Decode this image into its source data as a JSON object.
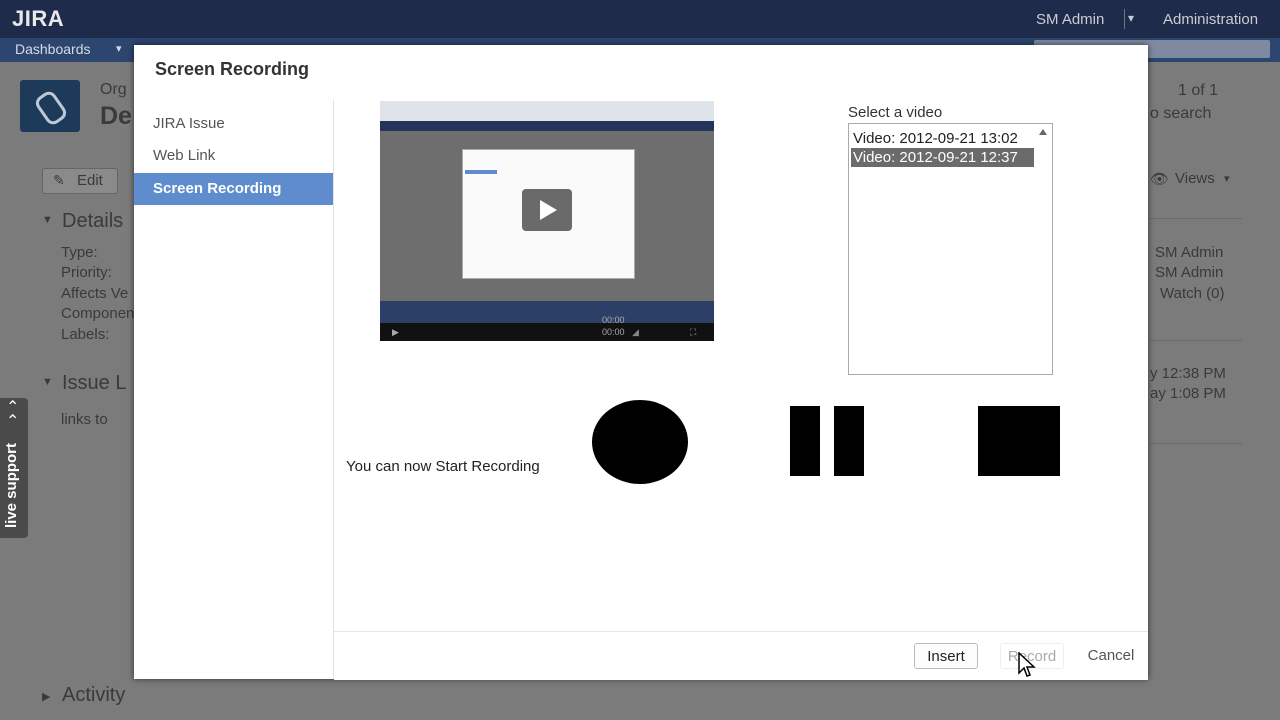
{
  "header": {
    "logo": "JIRA",
    "user": "SM Admin",
    "administration": "Administration"
  },
  "nav": {
    "dashboards": "Dashboards"
  },
  "background": {
    "project_org": "Org",
    "project_title": "De",
    "pager": "1 of 1",
    "return_search": "o search",
    "edit": "Edit",
    "views": "Views",
    "details_heading": "Details",
    "details_labels": [
      "Type:",
      "Priority:",
      "Affects Ve",
      "Componen",
      "Labels:"
    ],
    "people": [
      "SM Admin",
      "SM Admin",
      "Watch (0)"
    ],
    "dates": [
      "y 12:38 PM",
      "ay 1:08 PM"
    ],
    "issue_links_heading": "Issue L",
    "links_to": "links to",
    "activity_heading": "Activity",
    "live_support": "live support"
  },
  "dialog": {
    "title": "Screen Recording",
    "sidebar": [
      {
        "label": "JIRA Issue",
        "active": false
      },
      {
        "label": "Web Link",
        "active": false
      },
      {
        "label": "Screen Recording",
        "active": true
      }
    ],
    "select_label": "Select a video",
    "videos": [
      {
        "label": "Video: 2012-09-21 13:02",
        "selected": false
      },
      {
        "label": "Video: 2012-09-21 12:37",
        "selected": true
      }
    ],
    "thumbnail": {
      "time_current": "00:00",
      "time_total": "00:00"
    },
    "status_message": "You can now Start Recording",
    "footer": {
      "insert": "Insert",
      "record": "Record",
      "cancel": "Cancel"
    }
  }
}
